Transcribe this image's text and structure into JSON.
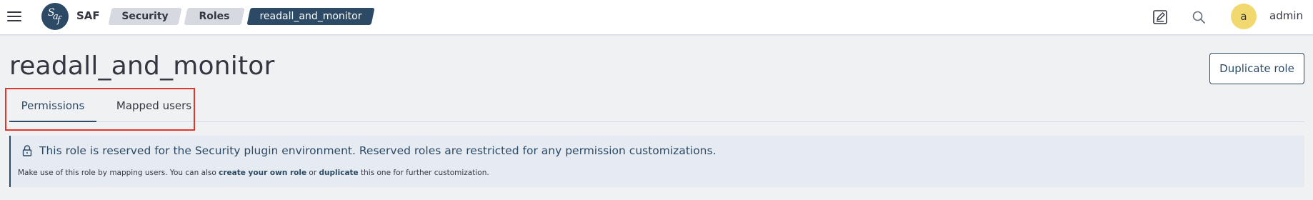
{
  "header": {
    "app_name": "SAF",
    "logo": {
      "text_1": "S",
      "text_2": "a",
      "text_3": "f"
    },
    "breadcrumbs": [
      {
        "label": "Security"
      },
      {
        "label": "Roles"
      },
      {
        "label": "readall_and_monitor"
      }
    ],
    "icons": {
      "menu": "hamburger-icon",
      "edit": "edit-icon",
      "search": "search-icon"
    },
    "user": {
      "avatar_letter": "a",
      "name": "admin"
    }
  },
  "page": {
    "title": "readall_and_monitor",
    "duplicate_button": "Duplicate role",
    "tabs": [
      {
        "label": "Permissions",
        "selected": true
      },
      {
        "label": "Mapped users",
        "selected": false
      }
    ]
  },
  "callout": {
    "icon": "lock-icon",
    "title": "This role is reserved for the Security plugin environment. Reserved roles are restricted for any permission customizations.",
    "body_prefix": "Make use of this role by mapping users. You can also ",
    "link_create": "create your own role",
    "body_middle": " or ",
    "link_duplicate": "duplicate",
    "body_suffix": " this one for further customization."
  },
  "colors": {
    "accent": "#2c4a66",
    "highlight": "#e0362b",
    "avatar": "#f1d86f",
    "callout_bg": "#e6ebf2"
  }
}
